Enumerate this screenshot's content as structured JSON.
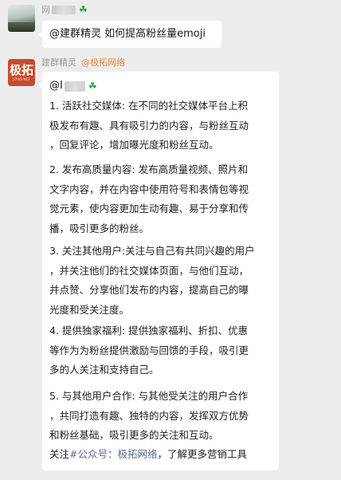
{
  "messages": [
    {
      "sender_prefix": "网",
      "text": "@建群精灵 如何提高粉丝量emoji"
    },
    {
      "sender_name": "建群精灵",
      "sender_org": "@极拓网络",
      "avatar": {
        "logo_main": "极拓",
        "logo_sub": "JITUO.NET"
      },
      "mention_prefix": "@",
      "mention_initial": "I",
      "paragraphs": [
        {
          "lines": [
            "1. 活跃社交媒体: 在不同的社交媒体平台上积",
            "极发布有趣、具有吸引力的内容，与粉丝互动",
            "，回复评论，增加曝光度和粉丝互动。"
          ]
        },
        {
          "lines": [
            "2. 发布高质量内容: 发布高质量视频、照片和",
            "文字内容，并在内容中使用符号和表情包等视",
            "觉元素，使内容更加生动有趣、易于分享和传",
            "播，吸引更多的粉丝。"
          ]
        },
        {
          "lines": [
            "3. 关注其他用户:关注与自己有共同兴趣的用户",
            "，并关注他们的社交媒体页面，与他们互动，",
            "并点赞、分享他们发布的内容，提高自己的曝",
            "光度和受关注度。"
          ]
        },
        {
          "lines": [
            "4. 提供独家福利: 提供独家福利、折扣、优惠",
            "等作为为粉丝提供激励与回馈的手段，吸引更",
            "多的人关注和支持自己。"
          ]
        },
        {
          "lines": [
            "5. 与其他用户合作: 与其他受关注的用户合作",
            "，共同打造有趣、独特的内容，发挥双方优势",
            "和粉丝基础，吸引更多的关注和互动。"
          ]
        }
      ],
      "footer": {
        "prefix": "关注",
        "link_text": "#公众号：极拓网络",
        "suffix": "，了解更多营销工具"
      }
    }
  ],
  "colors": {
    "background": "#ededed",
    "bubble": "#ffffff",
    "link": "#576b95",
    "org_tag": "#e8832a",
    "avatar_brand": "#c84b2b"
  },
  "icons": {
    "clover": "four-leaf-clover-icon"
  }
}
